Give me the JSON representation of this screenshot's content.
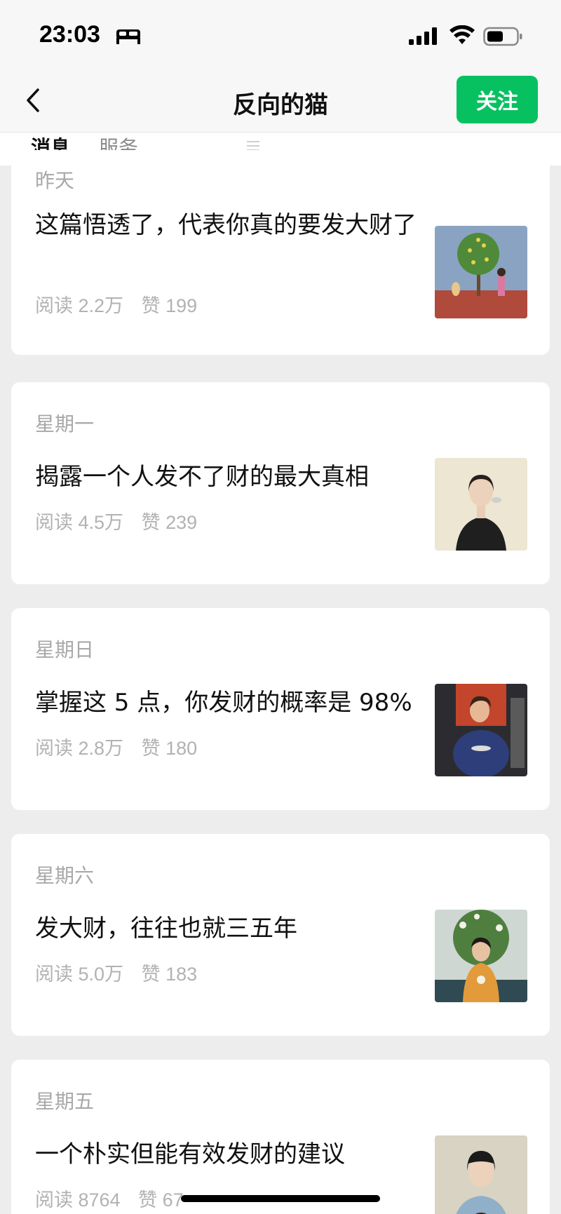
{
  "status_bar": {
    "time": "23:03",
    "icons": [
      "sleep-icon",
      "signal-icon",
      "wifi-icon",
      "battery-icon"
    ]
  },
  "nav": {
    "title": "反向的猫",
    "follow_label": "关注",
    "back_icon": "chevron-left-icon"
  },
  "tabs": {
    "messages": "消息",
    "services": "服务",
    "menu_icon": "menu-icon"
  },
  "articles": [
    {
      "date": "昨天",
      "title": "这篇悟透了，代表你真的要发大财了",
      "reads": "阅读 2.2万",
      "likes": "赞 199",
      "thumb": "lemon-tree-painting"
    },
    {
      "date": "星期一",
      "title": "揭露一个人发不了财的最大真相",
      "reads": "阅读 4.5万",
      "likes": "赞 239",
      "thumb": "woman-with-bird-painting"
    },
    {
      "date": "星期日",
      "title": "掌握这 5 点，你发财的概率是 98%",
      "reads": "阅读 2.8万",
      "likes": "赞 180",
      "thumb": "woman-with-fish-painting"
    },
    {
      "date": "星期六",
      "title": "发大财，往往也就三五年",
      "reads": "阅读 5.0万",
      "likes": "赞 183",
      "thumb": "girl-with-cat-shirt-painting"
    },
    {
      "date": "星期五",
      "title": "一个朴实但能有效发财的建议",
      "reads": "阅读 8764",
      "likes": "赞 67",
      "thumb": "girl-in-blue-painting"
    }
  ],
  "colors": {
    "accent": "#07c160",
    "background": "#ededed",
    "card": "#ffffff",
    "muted_text": "#a8a8a8"
  }
}
